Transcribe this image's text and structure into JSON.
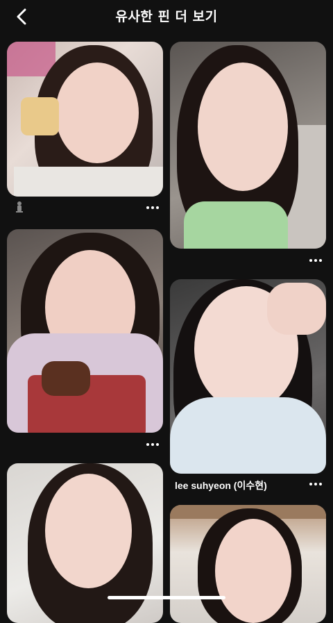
{
  "header": {
    "title": "유사한 핀 더 보기",
    "back_icon": "chevron-left-icon"
  },
  "pins": [
    {
      "id": "pin-1",
      "column": "left",
      "caption": "",
      "has_attribution_icon": true
    },
    {
      "id": "pin-2",
      "column": "right",
      "caption": ""
    },
    {
      "id": "pin-3",
      "column": "left",
      "caption": ""
    },
    {
      "id": "pin-4",
      "column": "right",
      "caption": "lee suhyeon (이수현)"
    },
    {
      "id": "pin-5",
      "column": "left",
      "caption": ""
    },
    {
      "id": "pin-6",
      "column": "right",
      "caption": ""
    }
  ],
  "colors": {
    "background": "#111111",
    "text": "#ffffff"
  }
}
